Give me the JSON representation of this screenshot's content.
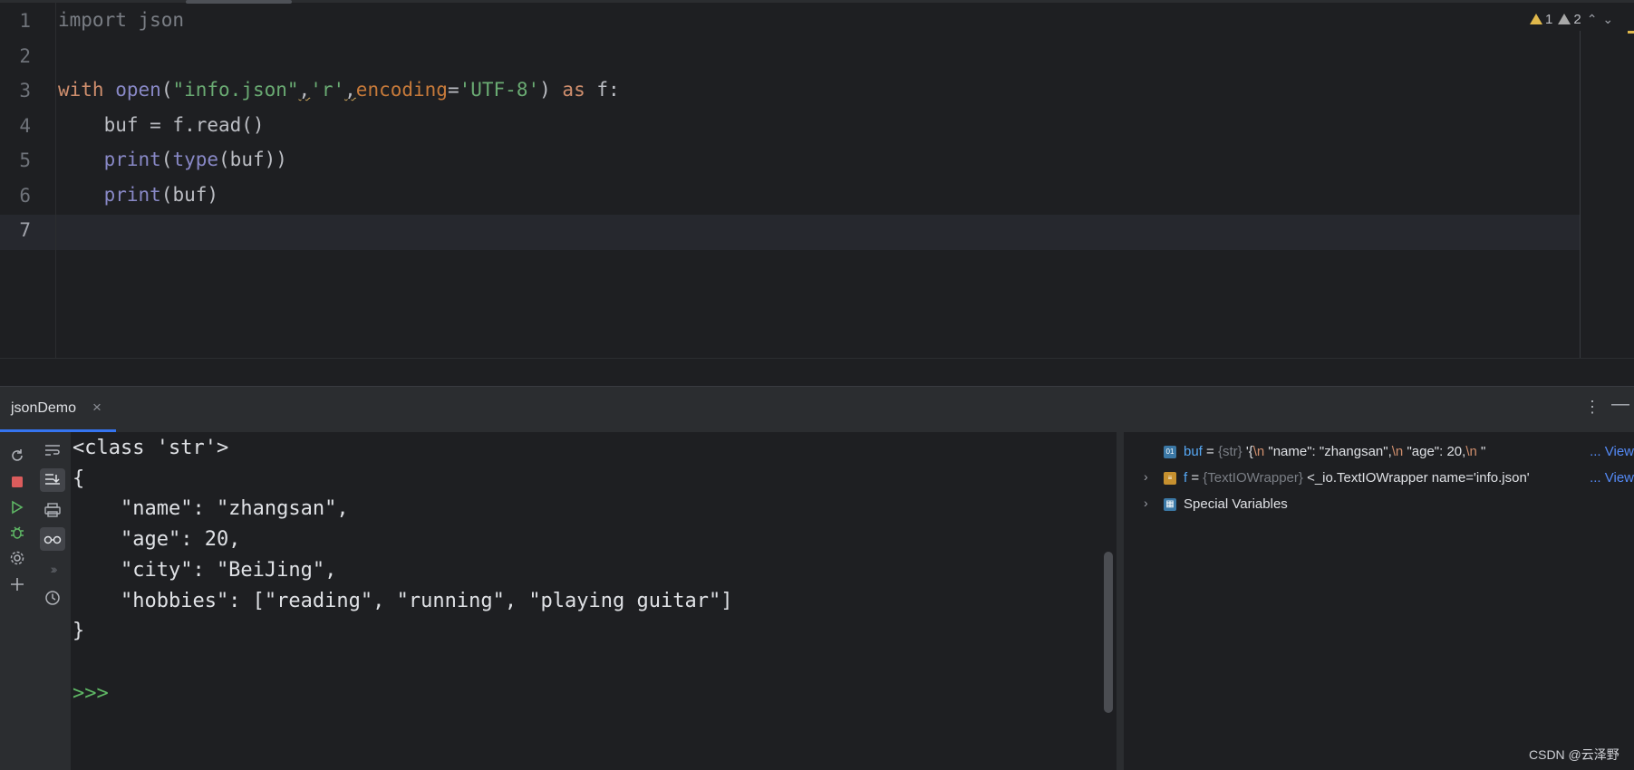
{
  "editor": {
    "line_numbers": [
      "1",
      "2",
      "3",
      "4",
      "5",
      "6",
      "7"
    ],
    "current_line": "7",
    "lines": {
      "l1": "import json",
      "l3": {
        "with": "with",
        "open": "open",
        "p1": "(",
        "s1": "\"info.json\"",
        "c1": ",",
        "s2": "'r'",
        "c2": ",",
        "enc": "encoding",
        "eq": "=",
        "s3": "'UTF-8'",
        "p2": ")",
        "as": " as",
        "f": " f:"
      },
      "l4": "    buf = f.read()",
      "l5": {
        "indent": "    ",
        "print": "print",
        "p1": "(",
        "type": "type",
        "rest": "(buf))"
      },
      "l6": {
        "indent": "    ",
        "print": "print",
        "rest": "(buf)"
      }
    },
    "inspections": {
      "warnings": "1",
      "weak_warnings": "2"
    }
  },
  "toolwindow": {
    "tab_label": "jsonDemo",
    "tab_close": "×",
    "more": "⋮",
    "minimize": "—"
  },
  "console": {
    "lines": [
      "<class 'str'>",
      "{",
      "    \"name\": \"zhangsan\",",
      "    \"age\": 20,",
      "    \"city\": \"BeiJing\",",
      "    \"hobbies\": [\"reading\", \"running\", \"playing guitar\"]",
      "}"
    ],
    "prompt": ">>>"
  },
  "variables": {
    "buf": {
      "name": "buf",
      "eq": " = ",
      "type": "{str}",
      "v1": " '{",
      "n1": "\\n",
      "v2": "    \"name\": \"zhangsan\",",
      "n2": "\\n",
      "v3": "    \"age\": 20,",
      "n3": "\\n",
      "v4": "    \"",
      "view": "... View"
    },
    "f": {
      "name": "f",
      "eq": " = ",
      "type": "{TextIOWrapper}",
      "value": " <_io.TextIOWrapper name='info.json'",
      "view": "... View"
    },
    "special": "Special Variables"
  },
  "watermark": "CSDN @云泽野",
  "colors": {
    "accent": "#3574f0",
    "string": "#6aab73",
    "keyword": "#cf8e6d",
    "builtin": "#8888c6"
  }
}
